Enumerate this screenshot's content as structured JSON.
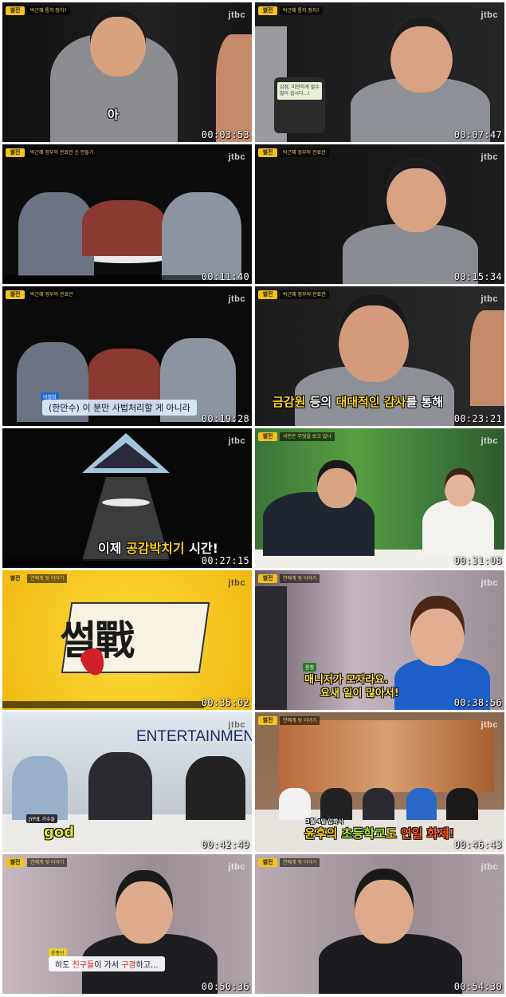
{
  "thumbnails": [
    {
      "timestamp": "00:03:53",
      "logo": "jtbc",
      "badge": "썰전",
      "headline": "박근혜 통치 정치?",
      "caption": "아",
      "bg": "#141414"
    },
    {
      "timestamp": "00:07:47",
      "logo": "jtbc",
      "badge": "썰전",
      "headline": "박근혜 통치 정치?",
      "phone_text": "김정, 미안하게 말수\n많이 씁시다...!",
      "bg": "#1a1a1a"
    },
    {
      "timestamp": "00:11:40",
      "logo": "jtbc",
      "badge": "썰전",
      "headline": "박근혜 정부의 관료관 신 만들기",
      "bg": "#0c0c0c"
    },
    {
      "timestamp": "00:15:34",
      "logo": "jtbc",
      "badge": "썰전",
      "headline": "박근혜 정부의 관료관",
      "bg": "#151515"
    },
    {
      "timestamp": "00:19:28",
      "logo": "jtbc",
      "badge": "썰전",
      "headline": "박근혜 정부의 관료관",
      "speaker_tag": "이철희",
      "subtitle": "(한만수) 이 분만 사법처리할 게 아니라",
      "bg": "#0b0b0b"
    },
    {
      "timestamp": "00:23:21",
      "logo": "jtbc",
      "badge": "썰전",
      "headline": "박근혜 정부의 관료관",
      "subtitle_parts": [
        "금감원",
        " 등의 ",
        "대대적인 감사",
        "를 통해"
      ],
      "bg": "#1b1b1b"
    },
    {
      "timestamp": "00:27:15",
      "logo": "jtbc",
      "caption_parts": [
        "이제 ",
        "공감박치기",
        " 시간!"
      ],
      "bg": "#080808"
    },
    {
      "timestamp": "00:31:08",
      "logo": "jtbc",
      "badge": "썰전",
      "headline": "국민은 무엇을 보고 있나",
      "bg": "#3a7a38"
    },
    {
      "timestamp": "00:35:02",
      "logo": "jtbc",
      "badge": "썰전",
      "headline": "연예계 뒷 이야기",
      "title_art": "썰戰",
      "bg": "#f2c418"
    },
    {
      "timestamp": "00:38:56",
      "logo": "jtbc",
      "badge": "썰전",
      "headline": "연예계 뒷 이야기",
      "speaker_tag": "윤정",
      "caption_lines": [
        "매니저가 모자라요.",
        "요새 일이 많아서!"
      ],
      "bg": "#a8a0a8"
    },
    {
      "timestamp": "00:42:49",
      "logo": "jtbc",
      "backdrop_text": "ENTERTAINMENT",
      "tag_text": "JYP표 가수들",
      "tag_big": "god",
      "bg": "#c8c8c8"
    },
    {
      "timestamp": "00:46:43",
      "logo": "jtbc",
      "badge": "썰전",
      "headline": "연예계 뒷 이야기",
      "caption_small": "3월 4일 입학식",
      "caption_parts": [
        "윤후의 ",
        "초등학교",
        "도 ",
        "연일 화제!"
      ],
      "bg": "#7a6050"
    },
    {
      "timestamp": "00:50:36",
      "logo": "jtbc",
      "badge": "썰전",
      "headline": "연예계 뒷 이야기",
      "speaker_tag": "윤종신",
      "caption_parts": [
        "하도 ",
        "친구들",
        "이 가서 ",
        "구경",
        "하고..."
      ],
      "bg": "#b6a8ae"
    },
    {
      "timestamp": "00:54:30",
      "logo": "jtbc",
      "badge": "썰전",
      "headline": "연예계 뒷 이야기",
      "bg": "#b0a4aa"
    }
  ]
}
